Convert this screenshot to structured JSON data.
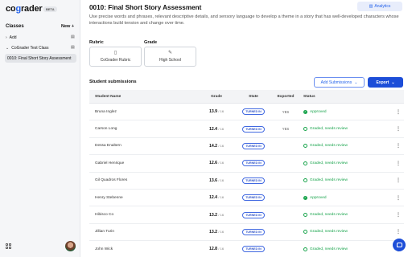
{
  "app": {
    "logo": "cograder",
    "beta": "BETA"
  },
  "sidebar": {
    "title": "Classes",
    "new_label": "New +",
    "add_label": "Add",
    "class_name": "CoGrader Test Class",
    "active_item": "0010: Final Short Story Assessment"
  },
  "header": {
    "title": "0010: Final Short Story Assessment",
    "analytics_label": "Analytics",
    "description": "Use precise words and phrases, relevant descriptive details, and sensory language to develop a theme in a story that has well-developed characters whose interactions build tension and change over time."
  },
  "rubric": {
    "label": "Rubric",
    "value": "CoGrader Rubric"
  },
  "grade": {
    "label": "Grade",
    "value": "High School"
  },
  "submissions": {
    "title": "Student submissions",
    "add_label": "Add Submissions",
    "export_label": "Export",
    "columns": {
      "name": "Student Name",
      "grade": "Grade",
      "state": "State",
      "exported": "Exported",
      "status": "Status"
    },
    "rows": [
      {
        "name": "Bruna Inglez",
        "score": "13.9",
        "total": "/ 16",
        "state": "TURNED IN",
        "exported": "YES",
        "status": "Approved",
        "approved": true
      },
      {
        "name": "Carson Long",
        "score": "12.4",
        "total": "/ 16",
        "state": "TURNED IN",
        "exported": "YES",
        "status": "Graded, needs review",
        "approved": false
      },
      {
        "name": "Dessa Enaltern",
        "score": "14.2",
        "total": "/ 16",
        "state": "TURNED IN",
        "exported": "",
        "status": "Graded, needs review",
        "approved": false
      },
      {
        "name": "Gabriel Henrique",
        "score": "12.6",
        "total": "/ 16",
        "state": "TURNED IN",
        "exported": "",
        "status": "Graded, needs review",
        "approved": false
      },
      {
        "name": "Gil Quadros Flores",
        "score": "13.6",
        "total": "/ 16",
        "state": "TURNED IN",
        "exported": "",
        "status": "Graded, needs review",
        "approved": false
      },
      {
        "name": "Henry Stebenne",
        "score": "12.4",
        "total": "/ 16",
        "state": "TURNED IN",
        "exported": "",
        "status": "Approved",
        "approved": true
      },
      {
        "name": "Hibisco Co",
        "score": "13.2",
        "total": "/ 16",
        "state": "TURNED IN",
        "exported": "",
        "status": "Graded, needs review",
        "approved": false
      },
      {
        "name": "Jillian Turin",
        "score": "13.2",
        "total": "/ 16",
        "state": "TURNED IN",
        "exported": "",
        "status": "Graded, needs review",
        "approved": false
      },
      {
        "name": "John Wick",
        "score": "12.8",
        "total": "/ 16",
        "state": "TURNED IN",
        "exported": "",
        "status": "Graded, needs review",
        "approved": false
      }
    ]
  },
  "colors": {
    "accent": "#1d4ed8",
    "success": "#16a34a"
  }
}
